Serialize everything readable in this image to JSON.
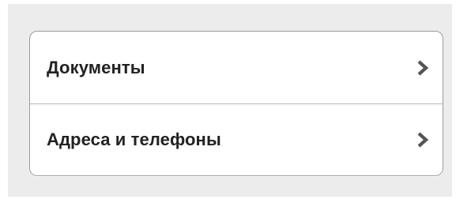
{
  "menu": {
    "items": [
      {
        "label": "Документы",
        "icon": "chevron-right-icon"
      },
      {
        "label": "Адреса и телефоны",
        "icon": "chevron-right-icon"
      }
    ]
  },
  "colors": {
    "background": "#ececec",
    "card": "#ffffff",
    "border": "#9c9c9c",
    "separator": "#b8b8b8",
    "text": "#222222",
    "chevron": "#555555"
  }
}
